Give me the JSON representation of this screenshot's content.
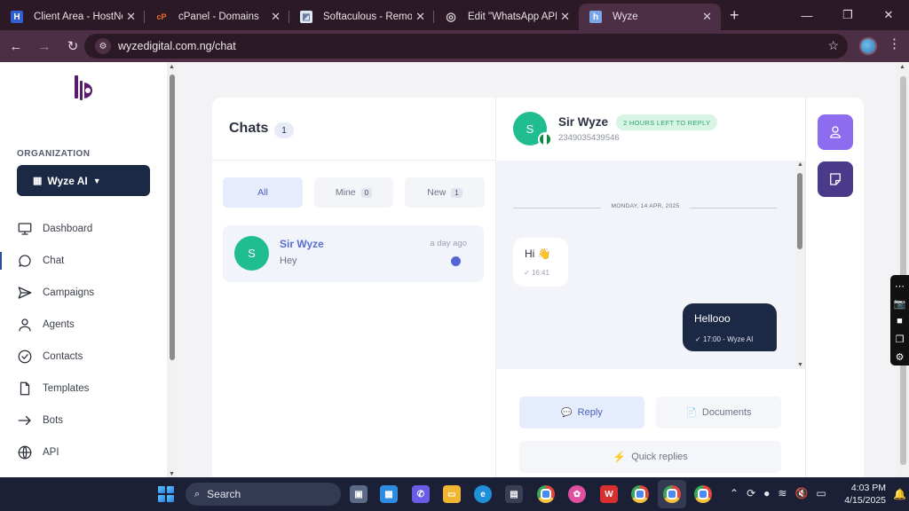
{
  "browser": {
    "tabs": [
      {
        "title": "Client Area - HostNowNow",
        "color": "#2f5fd0",
        "glyph": "H"
      },
      {
        "title": "cPanel - Domains",
        "color": "#f36d21",
        "glyph": "cP"
      },
      {
        "title": "Softaculous - Remove",
        "color": "#6a7ba0",
        "glyph": "◩"
      },
      {
        "title": "Edit \"WhatsApp API\" with",
        "color": "#5b6270",
        "glyph": "◎"
      },
      {
        "title": "Wyze",
        "color": "#7aa6e8",
        "glyph": "h"
      }
    ],
    "url": "wyzedigital.com.ng/chat"
  },
  "sidebar": {
    "org_label": "ORGANIZATION",
    "org_name": "Wyze AI",
    "items": [
      {
        "label": "Dashboard",
        "icon": "monitor-icon"
      },
      {
        "label": "Chat",
        "icon": "chat-bubble-icon"
      },
      {
        "label": "Campaigns",
        "icon": "send-icon"
      },
      {
        "label": "Agents",
        "icon": "user-icon"
      },
      {
        "label": "Contacts",
        "icon": "check-circle-icon"
      },
      {
        "label": "Templates",
        "icon": "document-icon"
      },
      {
        "label": "Bots",
        "icon": "arrow-right-icon"
      },
      {
        "label": "API",
        "icon": "globe-icon"
      }
    ]
  },
  "chats": {
    "title": "Chats",
    "count": "1",
    "filters": [
      {
        "label": "All",
        "count": ""
      },
      {
        "label": "Mine",
        "count": "0"
      },
      {
        "label": "New",
        "count": "1"
      }
    ],
    "conversation": {
      "initial": "S",
      "name": "Sir Wyze",
      "last_message": "Hey",
      "time": "a day ago"
    }
  },
  "conversation": {
    "initial": "S",
    "name": "Sir Wyze",
    "badge": "2 HOURS LEFT TO REPLY",
    "phone": "2349035439546",
    "date_divider": "MONDAY, 14 APR, 2025",
    "incoming": {
      "text": "Hi 👋",
      "meta": "16:41"
    },
    "outgoing": {
      "text": "Hellooo",
      "meta": "17:00 - Wyze AI"
    },
    "reply_tab": "Reply",
    "documents_tab": "Documents",
    "quick_replies": "Quick replies"
  },
  "taskbar": {
    "search": "Search",
    "time": "4:03 PM",
    "date": "4/15/2025"
  },
  "colors": {
    "brand_navy": "#1c2945",
    "accent_purple": "#8d6cf0",
    "avatar_green": "#1fbd8f"
  }
}
